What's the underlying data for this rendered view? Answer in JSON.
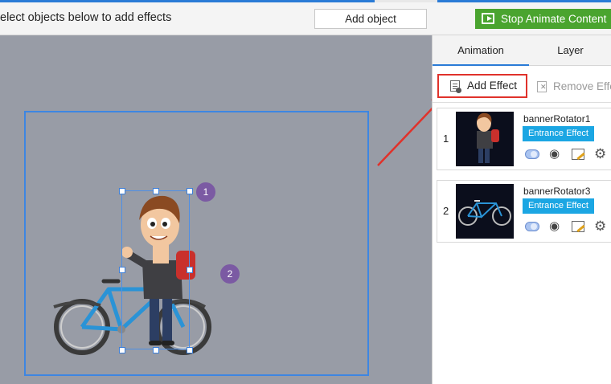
{
  "toolbar": {
    "instruction": "elect objects below to add effects",
    "add_object_label": "Add object",
    "stop_label": "Stop Animate Content"
  },
  "canvas": {
    "badges": [
      "1",
      "2"
    ]
  },
  "panel": {
    "tabs": [
      {
        "label": "Animation",
        "active": true
      },
      {
        "label": "Layer",
        "active": false
      }
    ],
    "add_effect_label": "Add Effect",
    "remove_effect_label": "Remove Effe",
    "effects": [
      {
        "index": "1",
        "name": "bannerRotator1",
        "effect": "Entrance Effect",
        "thumb": "character"
      },
      {
        "index": "2",
        "name": "bannerRotator3",
        "effect": "Entrance Effect",
        "thumb": "bicycle"
      }
    ]
  },
  "colors": {
    "accent_blue": "#2a7bd6",
    "stop_green": "#4aa42f",
    "highlight_red": "#e0322b",
    "entrance_blue": "#1ba6e3",
    "canvas_gray": "#989ca6",
    "badge_purple": "#7b5aa3"
  },
  "icons": {
    "stop": "stop-animate-icon",
    "add_effect": "add-effect-icon",
    "remove_effect": "remove-effect-icon",
    "row": [
      "toggle-icon",
      "eye-icon",
      "edit-icon",
      "gear-icon"
    ]
  }
}
